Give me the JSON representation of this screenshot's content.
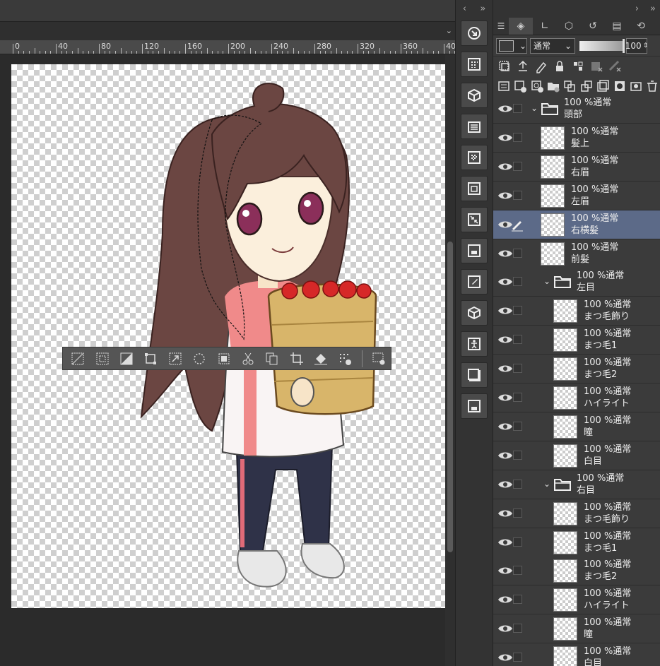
{
  "ruler": {
    "labels": [
      "0",
      "40",
      "80",
      "120",
      "160",
      "200",
      "240",
      "280",
      "320",
      "360",
      "40"
    ]
  },
  "panel": {
    "blend_mode": "通常",
    "opacity": "100",
    "layers": [
      {
        "kind": "folder",
        "indent": 0,
        "line1": "100 %通常",
        "line2": "頭部",
        "expanded": true
      },
      {
        "kind": "layer",
        "indent": 0,
        "line1": "100 %通常",
        "line2": "髪上"
      },
      {
        "kind": "layer",
        "indent": 0,
        "line1": "100 %通常",
        "line2": "右眉"
      },
      {
        "kind": "layer",
        "indent": 0,
        "line1": "100 %通常",
        "line2": "左眉"
      },
      {
        "kind": "layer",
        "indent": 0,
        "line1": "100 %通常",
        "line2": "右横髪",
        "selected": true
      },
      {
        "kind": "layer",
        "indent": 0,
        "line1": "100 %通常",
        "line2": "前髪"
      },
      {
        "kind": "folder",
        "indent": 1,
        "line1": "100 %通常",
        "line2": "左目",
        "expanded": true
      },
      {
        "kind": "layer",
        "indent": 1,
        "line1": "100 %通常",
        "line2": "まつ毛飾り"
      },
      {
        "kind": "layer",
        "indent": 1,
        "line1": "100 %通常",
        "line2": "まつ毛1"
      },
      {
        "kind": "layer",
        "indent": 1,
        "line1": "100 %通常",
        "line2": "まつ毛2"
      },
      {
        "kind": "layer",
        "indent": 1,
        "line1": "100 %通常",
        "line2": "ハイライト"
      },
      {
        "kind": "layer",
        "indent": 1,
        "line1": "100 %通常",
        "line2": "瞳"
      },
      {
        "kind": "layer",
        "indent": 1,
        "line1": "100 %通常",
        "line2": "白目"
      },
      {
        "kind": "folder",
        "indent": 1,
        "line1": "100 %通常",
        "line2": "右目",
        "expanded": true
      },
      {
        "kind": "layer",
        "indent": 1,
        "line1": "100 %通常",
        "line2": "まつ毛飾り"
      },
      {
        "kind": "layer",
        "indent": 1,
        "line1": "100 %通常",
        "line2": "まつ毛1"
      },
      {
        "kind": "layer",
        "indent": 1,
        "line1": "100 %通常",
        "line2": "まつ毛2"
      },
      {
        "kind": "layer",
        "indent": 1,
        "line1": "100 %通常",
        "line2": "ハイライト"
      },
      {
        "kind": "layer",
        "indent": 1,
        "line1": "100 %通常",
        "line2": "瞳"
      },
      {
        "kind": "layer",
        "indent": 1,
        "line1": "100 %通常",
        "line2": "白目"
      }
    ]
  },
  "selection_bar": {
    "icons": [
      "deselect-icon",
      "invert-selection-icon",
      "select-all-icon",
      "transform-icon",
      "scale-icon",
      "expand-selection-icon",
      "shrink-selection-icon",
      "cut-icon",
      "copy-paste-icon",
      "crop-icon",
      "fill-icon",
      "add-selection-icon",
      "selection-settings-icon"
    ]
  },
  "colors": {
    "selected_layer": "#5c6a88",
    "panel_bg": "#3b3b3b",
    "accent_shirt": "#f08a8a"
  }
}
